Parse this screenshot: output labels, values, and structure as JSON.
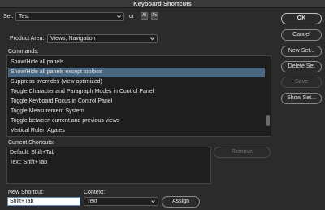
{
  "window": {
    "title": "Keyboard Shortcuts"
  },
  "set": {
    "label": "Set:",
    "value": "Test",
    "or_label": "or",
    "app_icons": [
      "Ai",
      "Ps"
    ]
  },
  "product_area": {
    "label": "Product Area:",
    "value": "Views, Navigation"
  },
  "commands": {
    "label": "Commands:",
    "items": [
      "Show/Hide all panels",
      "Show/Hide all panels except toolbox",
      "Suppress overrides (view optimized)",
      "Toggle Character and Paragraph Modes in Control Panel",
      "Toggle Keyboard Focus in Control Panel",
      "Toggle Measurement System",
      "Toggle between current and previous views",
      "Vertical Ruler: Agates"
    ],
    "selected_index": 1
  },
  "current_shortcuts": {
    "label": "Current Shortcuts:",
    "items": [
      "Default: Shift+Tab",
      "Text: Shift+Tab"
    ]
  },
  "new_shortcut": {
    "label": "New Shortcut:",
    "value": "Shift+Tab"
  },
  "context": {
    "label": "Context:",
    "value": "Text"
  },
  "buttons": {
    "ok": "OK",
    "cancel": "Cancel",
    "new_set": "New Set...",
    "delete_set": "Delete Set",
    "save": "Save",
    "show_set": "Show Set...",
    "remove": "Remove",
    "assign": "Assign"
  },
  "colors": {
    "background": "#2b2b2b",
    "selection": "#4a6781"
  }
}
